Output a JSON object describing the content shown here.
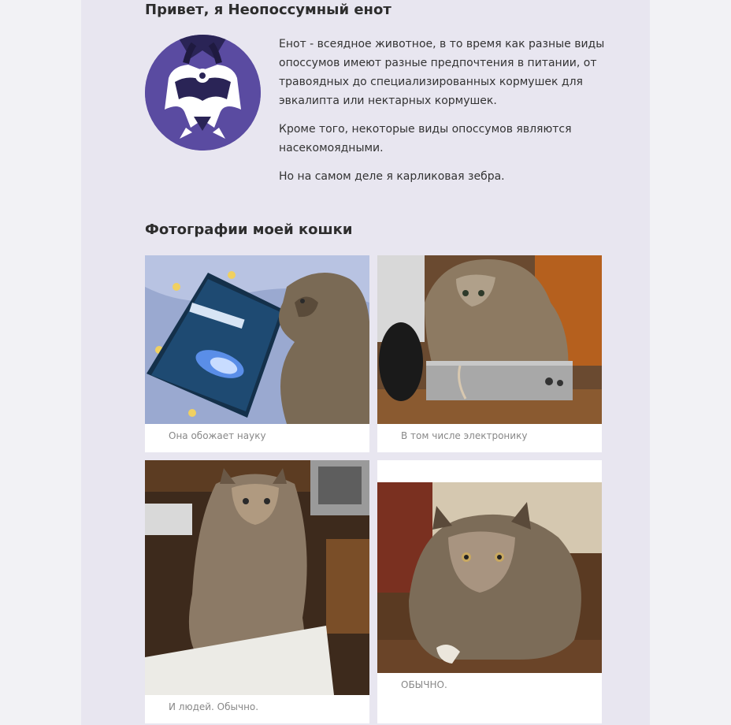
{
  "profile": {
    "title": "Привет, я Неопоссумный енот",
    "paragraphs": [
      "Енот - всеядное животное, в то время как разные виды опоссумов имеют разные предпочтения в питании, от травоядных до специализированных кормушек для эвкалипта или нектарных кормушек.",
      "Кроме того, некоторые виды опоссумов являются насекомоядными.",
      "Но на самом деле я карликовая зебра."
    ]
  },
  "gallery": {
    "title": "Фотографии моей кошки",
    "items": [
      {
        "caption": "Она обожает науку"
      },
      {
        "caption": "В том числе электронику"
      },
      {
        "caption": "И людей. Обычно."
      },
      {
        "caption": "ОБЫЧНО."
      }
    ]
  },
  "colors": {
    "page_bg": "#f2f2f5",
    "content_bg": "#e8e6f0",
    "avatar_bg": "#5a4ba1",
    "caption": "#888888"
  }
}
